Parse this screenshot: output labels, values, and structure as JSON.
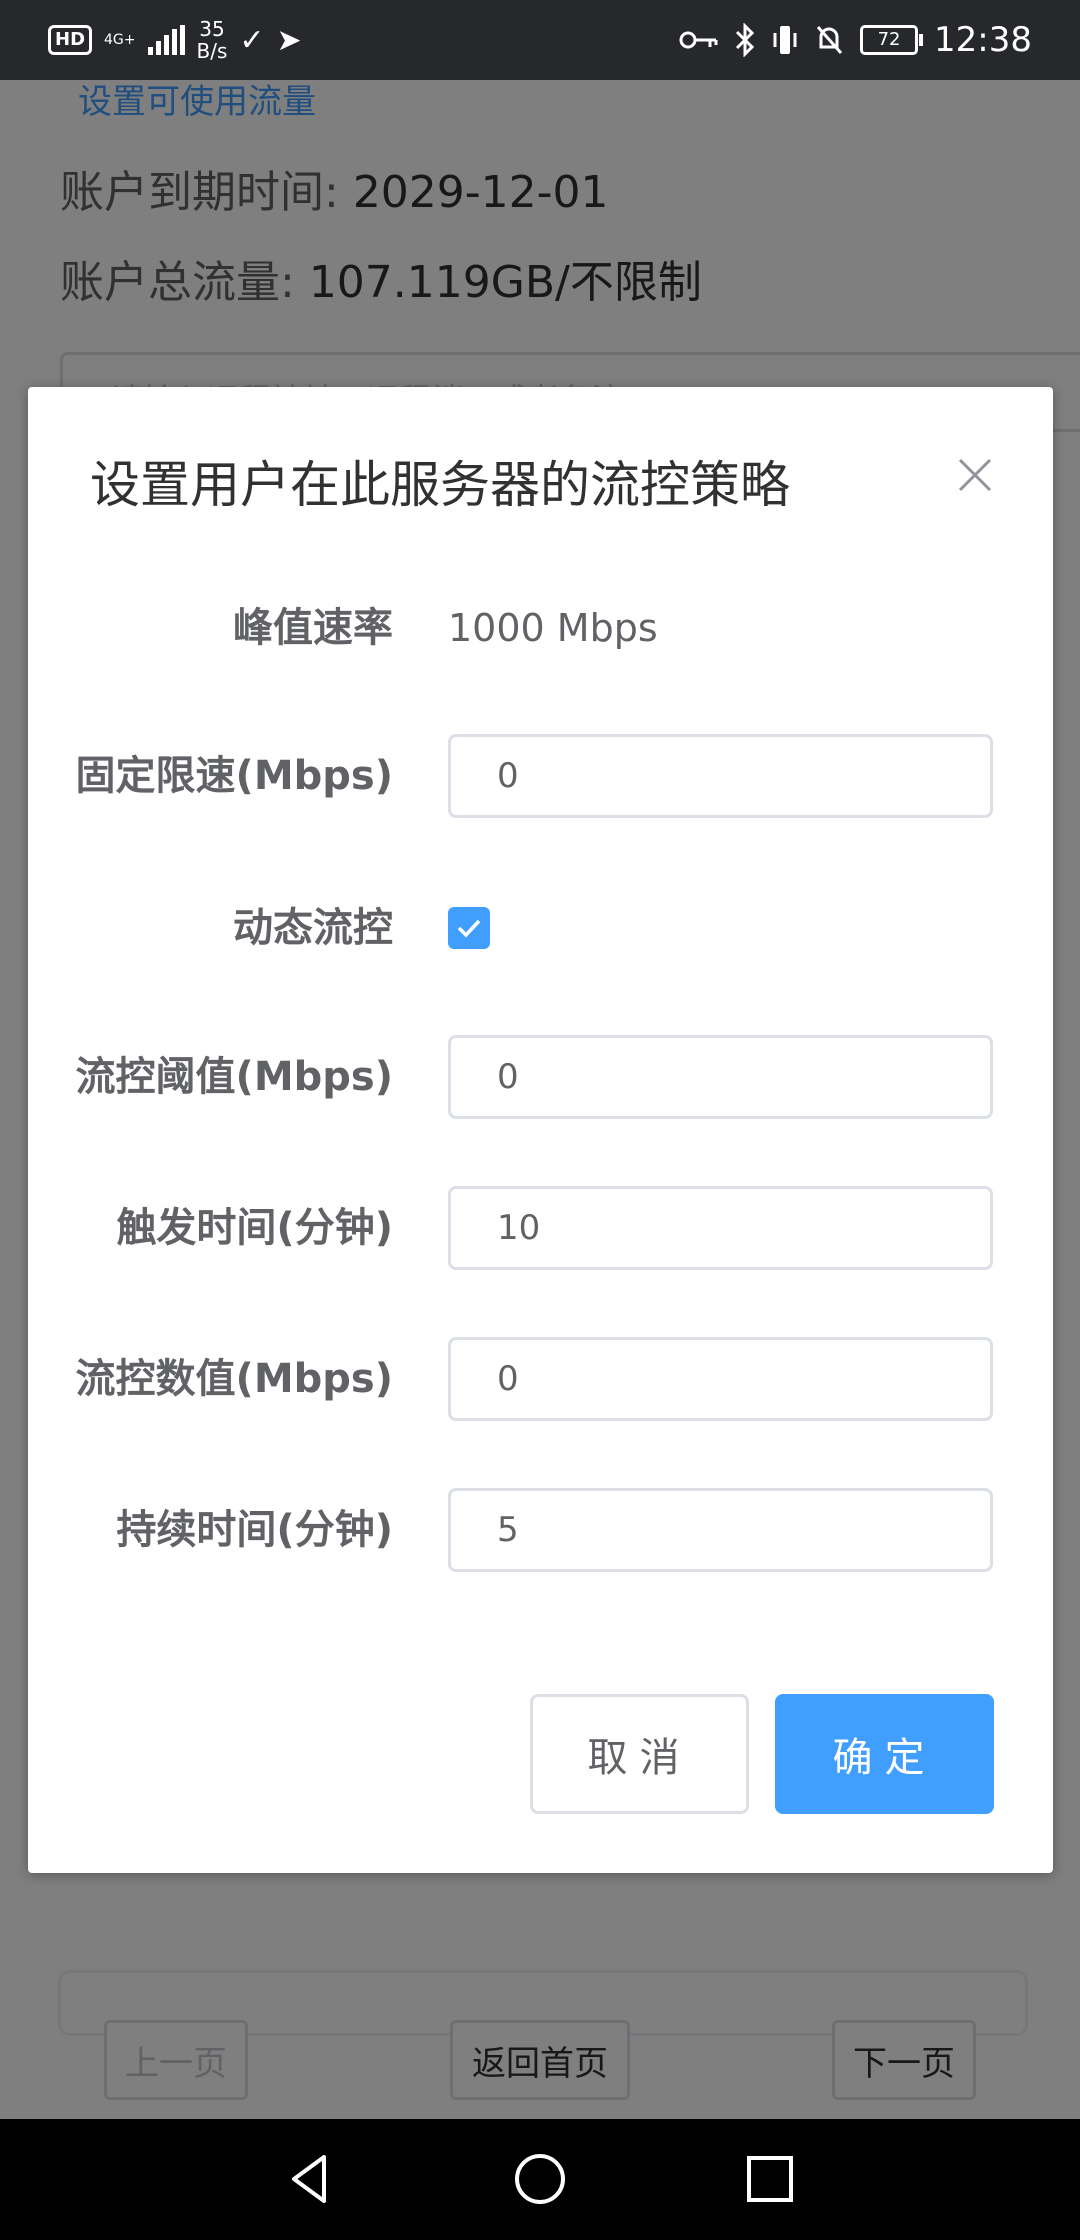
{
  "status_bar": {
    "hd": "HD",
    "network": "4G+",
    "speed_value": "35",
    "speed_unit": "B/s",
    "battery": "72",
    "time": "12:38"
  },
  "background": {
    "top_link": "设置可使用流量",
    "expire_label": "账户到期时间: ",
    "expire_value": "2029-12-01",
    "traffic_label": "账户总流量: ",
    "traffic_value": "107.119GB/不限制",
    "search_placeholder": "请输入远程地址、远程端口或者备注",
    "pager": {
      "prev": "上一页",
      "home": "返回首页",
      "next": "下一页"
    }
  },
  "dialog": {
    "title": "设置用户在此服务器的流控策略",
    "peak_rate": {
      "label": "峰值速率",
      "value": "1000 Mbps"
    },
    "fixed_limit": {
      "label": "固定限速(Mbps)",
      "value": "0"
    },
    "dynamic_control": {
      "label": "动态流控",
      "checked": true
    },
    "threshold": {
      "label": "流控阈值(Mbps)",
      "value": "0"
    },
    "trigger_time": {
      "label": "触发时间(分钟)",
      "value": "10"
    },
    "control_value": {
      "label": "流控数值(Mbps)",
      "value": "0"
    },
    "duration": {
      "label": "持续时间(分钟)",
      "value": "5"
    },
    "cancel_label": "取消",
    "confirm_label": "确定"
  },
  "colors": {
    "primary": "#409eff",
    "status_bar": "#26282c",
    "overlay": "rgba(0,0,0,0.5)"
  }
}
